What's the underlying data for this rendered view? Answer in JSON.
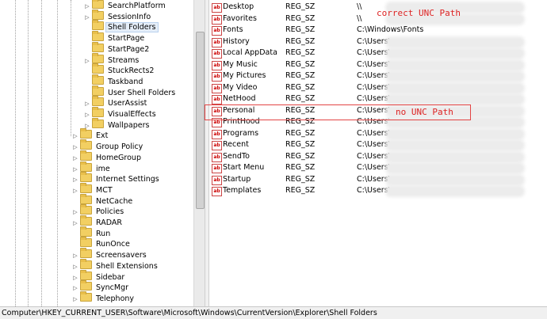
{
  "tree": {
    "items": [
      {
        "label": "SearchPlatform",
        "level": 2,
        "expander": true
      },
      {
        "label": "SessionInfo",
        "level": 2,
        "expander": true
      },
      {
        "label": "Shell Folders",
        "level": 2,
        "expander": false,
        "selected": true
      },
      {
        "label": "StartPage",
        "level": 2,
        "expander": false
      },
      {
        "label": "StartPage2",
        "level": 2,
        "expander": false
      },
      {
        "label": "Streams",
        "level": 2,
        "expander": true
      },
      {
        "label": "StuckRects2",
        "level": 2,
        "expander": false
      },
      {
        "label": "Taskband",
        "level": 2,
        "expander": false
      },
      {
        "label": "User Shell Folders",
        "level": 2,
        "expander": false
      },
      {
        "label": "UserAssist",
        "level": 2,
        "expander": true
      },
      {
        "label": "VisualEffects",
        "level": 2,
        "expander": true
      },
      {
        "label": "Wallpapers",
        "level": 2,
        "expander": true
      },
      {
        "label": "Ext",
        "level": 1,
        "expander": true
      },
      {
        "label": "Group Policy",
        "level": 1,
        "expander": true
      },
      {
        "label": "HomeGroup",
        "level": 1,
        "expander": true
      },
      {
        "label": "ime",
        "level": 1,
        "expander": true
      },
      {
        "label": "Internet Settings",
        "level": 1,
        "expander": true
      },
      {
        "label": "MCT",
        "level": 1,
        "expander": true
      },
      {
        "label": "NetCache",
        "level": 1,
        "expander": false
      },
      {
        "label": "Policies",
        "level": 1,
        "expander": true
      },
      {
        "label": "RADAR",
        "level": 1,
        "expander": true
      },
      {
        "label": "Run",
        "level": 1,
        "expander": false
      },
      {
        "label": "RunOnce",
        "level": 1,
        "expander": false
      },
      {
        "label": "Screensavers",
        "level": 1,
        "expander": true
      },
      {
        "label": "Shell Extensions",
        "level": 1,
        "expander": true
      },
      {
        "label": "Sidebar",
        "level": 1,
        "expander": true
      },
      {
        "label": "SyncMgr",
        "level": 1,
        "expander": true
      },
      {
        "label": "Telephony",
        "level": 1,
        "expander": true
      }
    ]
  },
  "values": {
    "rows": [
      {
        "name": "Desktop",
        "type": "REG_SZ",
        "data": "\\\\",
        "blurred": true
      },
      {
        "name": "Favorites",
        "type": "REG_SZ",
        "data": "\\\\",
        "blurred": true
      },
      {
        "name": "Fonts",
        "type": "REG_SZ",
        "data": "C:\\Windows\\Fonts",
        "blurred": false
      },
      {
        "name": "History",
        "type": "REG_SZ",
        "data": "C:\\Users\\",
        "blurred": true
      },
      {
        "name": "Local AppData",
        "type": "REG_SZ",
        "data": "C:\\Users\\",
        "blurred": true
      },
      {
        "name": "My Music",
        "type": "REG_SZ",
        "data": "C:\\Users\\",
        "blurred": true
      },
      {
        "name": "My Pictures",
        "type": "REG_SZ",
        "data": "C:\\Users\\",
        "blurred": true
      },
      {
        "name": "My Video",
        "type": "REG_SZ",
        "data": "C:\\Users\\",
        "blurred": true
      },
      {
        "name": "NetHood",
        "type": "REG_SZ",
        "data": "C:\\Users\\",
        "blurred": true
      },
      {
        "name": "Personal",
        "type": "REG_SZ",
        "data": "C:\\Users\\",
        "blurred": true
      },
      {
        "name": "PrintHood",
        "type": "REG_SZ",
        "data": "C:\\Users\\",
        "blurred": true
      },
      {
        "name": "Programs",
        "type": "REG_SZ",
        "data": "C:\\Users\\",
        "blurred": true
      },
      {
        "name": "Recent",
        "type": "REG_SZ",
        "data": "C:\\Users\\",
        "blurred": true
      },
      {
        "name": "SendTo",
        "type": "REG_SZ",
        "data": "C:\\Users\\",
        "blurred": true
      },
      {
        "name": "Start Menu",
        "type": "REG_SZ",
        "data": "C:\\Users\\",
        "blurred": true
      },
      {
        "name": "Startup",
        "type": "REG_SZ",
        "data": "C:\\Users\\",
        "blurred": true
      },
      {
        "name": "Templates",
        "type": "REG_SZ",
        "data": "C:\\Users\\",
        "blurred": true
      }
    ]
  },
  "annotations": {
    "correct_unc": "correct UNC Path",
    "no_unc": "no UNC Path",
    "color": "#dd2222"
  },
  "statusbar": {
    "path": "Computer\\HKEY_CURRENT_USER\\Software\\Microsoft\\Windows\\CurrentVersion\\Explorer\\Shell Folders"
  },
  "colors": {
    "folder": "#f2cf62",
    "selection": "#e5eef9"
  },
  "icons": {
    "tree_item": "folder-icon",
    "value_item": "string-value-icon"
  }
}
